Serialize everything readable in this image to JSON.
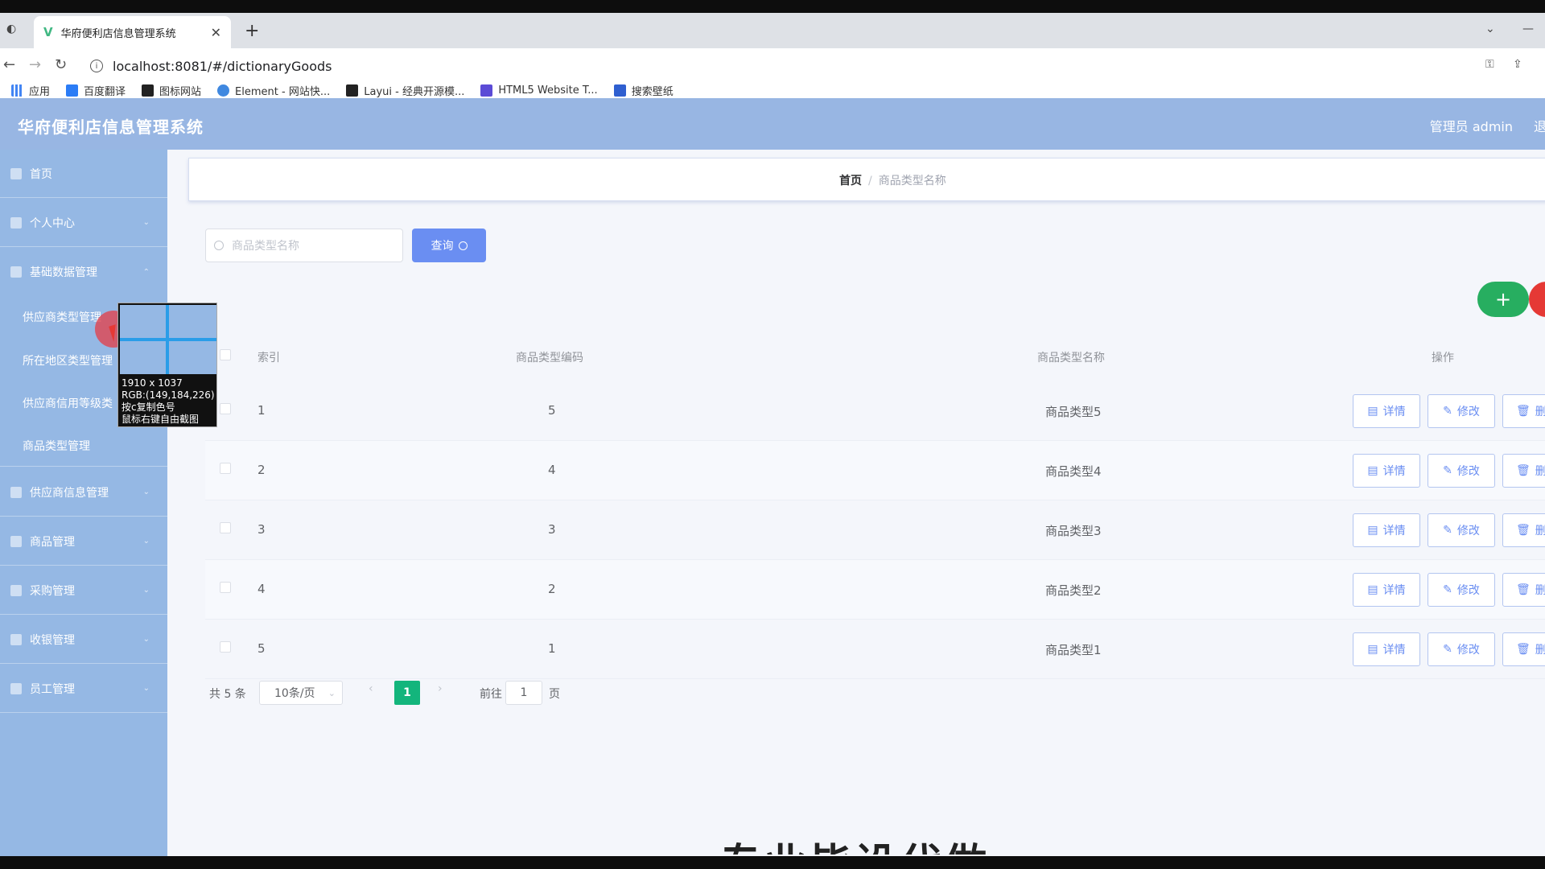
{
  "browser": {
    "tab_title": "华府便利店信息管理系统",
    "url": "localhost:8081/#/dictionaryGoods",
    "bookmarks": [
      "应用",
      "百度翻译",
      "图标网站",
      "Element - 网站快...",
      "Layui - 经典开源模...",
      "HTML5 Website T...",
      "搜索壁纸"
    ]
  },
  "header": {
    "title": "华府便利店信息管理系统",
    "admin": "管理员 admin",
    "logout": "退"
  },
  "sidebar": {
    "items": [
      {
        "label": "首页"
      },
      {
        "label": "个人中心"
      },
      {
        "label": "基础数据管理"
      },
      {
        "label": "供应商类型管理"
      },
      {
        "label": "所在地区类型管理"
      },
      {
        "label": "供应商信用等级类"
      },
      {
        "label": "商品类型管理"
      },
      {
        "label": "供应商信息管理"
      },
      {
        "label": "商品管理"
      },
      {
        "label": "采购管理"
      },
      {
        "label": "收银管理"
      },
      {
        "label": "员工管理"
      }
    ]
  },
  "magnifier": {
    "size": "1910 x 1037",
    "rgb": "RGB:(149,184,226)",
    "hint1": "按c复制色号",
    "hint2": "鼠标右键自由截图"
  },
  "breadcrumb": {
    "home": "首页",
    "sep": "/",
    "current": "商品类型名称"
  },
  "search": {
    "placeholder": "商品类型名称",
    "button": "查询"
  },
  "actions": {
    "add": "+"
  },
  "table": {
    "headers": {
      "index": "索引",
      "code": "商品类型编码",
      "name": "商品类型名称",
      "op": "操作"
    },
    "buttons": {
      "detail": "详情",
      "edit": "修改",
      "delete": "删"
    },
    "rows": [
      {
        "index": "1",
        "code": "5",
        "name": "商品类型5"
      },
      {
        "index": "2",
        "code": "4",
        "name": "商品类型4"
      },
      {
        "index": "3",
        "code": "3",
        "name": "商品类型3"
      },
      {
        "index": "4",
        "code": "2",
        "name": "商品类型2"
      },
      {
        "index": "5",
        "code": "1",
        "name": "商品类型1"
      }
    ]
  },
  "pagination": {
    "total": "共 5 条",
    "page_size": "10条/页",
    "current_page": "1",
    "goto_label": "前往",
    "goto_value": "1",
    "page_suffix": "页"
  },
  "overlay": {
    "watermark": "专业毕设代做"
  },
  "colors": {
    "header_bg": "#98b6e3",
    "sidebar_bg": "#95b8e4",
    "primary": "#6a8ef2",
    "success": "#27ae60",
    "danger": "#e53935",
    "page_active": "#13b57c"
  }
}
